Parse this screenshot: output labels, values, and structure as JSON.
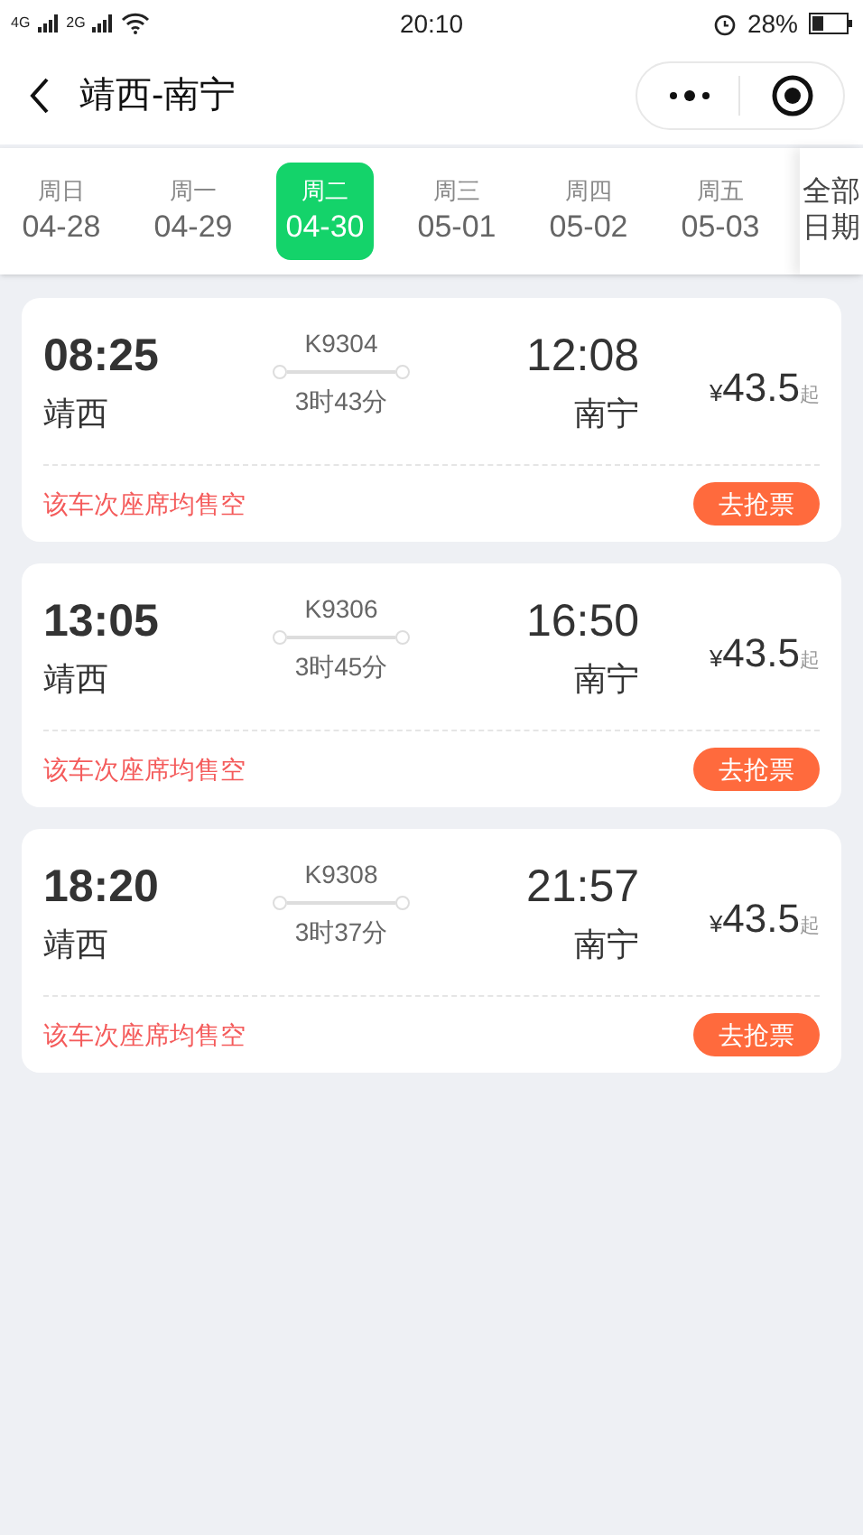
{
  "status_bar": {
    "network_1": "4G",
    "network_2": "2G",
    "time": "20:10",
    "battery": "28%"
  },
  "header": {
    "title": "靖西-南宁"
  },
  "dates": [
    {
      "weekday": "周日",
      "date": "04-28",
      "selected": false
    },
    {
      "weekday": "周一",
      "date": "04-29",
      "selected": false
    },
    {
      "weekday": "周二",
      "date": "04-30",
      "selected": true
    },
    {
      "weekday": "周三",
      "date": "05-01",
      "selected": false
    },
    {
      "weekday": "周四",
      "date": "05-02",
      "selected": false
    },
    {
      "weekday": "周五",
      "date": "05-03",
      "selected": false
    }
  ],
  "all_dates": {
    "line_1": "全部",
    "line_2": "日期"
  },
  "trains": [
    {
      "depart_time": "08:25",
      "depart_station": "靖西",
      "train_no": "K9304",
      "duration": "3时43分",
      "arrive_time": "12:08",
      "arrive_station": "南宁",
      "currency": "¥",
      "price": "43.5",
      "price_suffix": "起",
      "status": "该车次座席均售空",
      "action": "去抢票"
    },
    {
      "depart_time": "13:05",
      "depart_station": "靖西",
      "train_no": "K9306",
      "duration": "3时45分",
      "arrive_time": "16:50",
      "arrive_station": "南宁",
      "currency": "¥",
      "price": "43.5",
      "price_suffix": "起",
      "status": "该车次座席均售空",
      "action": "去抢票"
    },
    {
      "depart_time": "18:20",
      "depart_station": "靖西",
      "train_no": "K9308",
      "duration": "3时37分",
      "arrive_time": "21:57",
      "arrive_station": "南宁",
      "currency": "¥",
      "price": "43.5",
      "price_suffix": "起",
      "status": "该车次座席均售空",
      "action": "去抢票"
    }
  ]
}
